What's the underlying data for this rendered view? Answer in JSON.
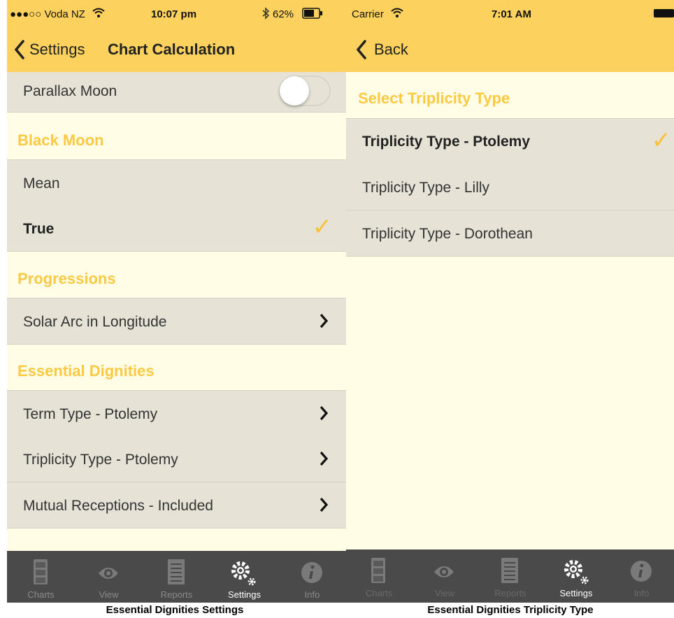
{
  "left_screen": {
    "status": {
      "signal": "●●●○○ Voda NZ",
      "time": "10:07 pm",
      "battery": "62%"
    },
    "nav": {
      "back_label": "Settings",
      "title": "Chart Calculation"
    },
    "rows": {
      "parallax_moon": "Parallax Moon",
      "black_moon_header": "Black Moon",
      "mean": "Mean",
      "true": "True",
      "progressions_header": "Progressions",
      "solar_arc": "Solar Arc in Longitude",
      "essential_header": "Essential Dignities",
      "term_type": "Term Type - Ptolemy",
      "triplicity_type": "Triplicity Type - Ptolemy",
      "mutual_receptions": "Mutual Receptions - Included"
    },
    "toggle_parallax_moon": "off",
    "tabs": [
      "Charts",
      "View",
      "Reports",
      "Settings",
      "Info"
    ],
    "caption": "Essential Dignities Settings"
  },
  "right_screen": {
    "status": {
      "carrier": "Carrier",
      "time": "7:01 AM"
    },
    "nav": {
      "back_label": "Back"
    },
    "section_header": "Select Triplicity Type",
    "options": [
      "Triplicity Type - Ptolemy",
      "Triplicity Type - Lilly",
      "Triplicity Type - Dorothean"
    ],
    "selected_option": "Triplicity Type - Ptolemy",
    "tabs": [
      "Charts",
      "View",
      "Reports",
      "Settings",
      "Info"
    ],
    "caption": "Essential Dignities Triplicity Type"
  },
  "colors": {
    "accent": "#fdd15d",
    "header_text": "#fcc943",
    "row_bg": "#e6e3d6",
    "page_bg": "#fffde6",
    "tabbar": "#4a4a4a",
    "check": "#f8c23b"
  },
  "icons": [
    "chevron-left-icon",
    "chevron-right-icon",
    "checkmark-icon",
    "wifi-icon",
    "bluetooth-icon",
    "battery-icon",
    "cabinet-icon",
    "eye-icon",
    "document-icon",
    "gears-icon",
    "info-icon"
  ]
}
